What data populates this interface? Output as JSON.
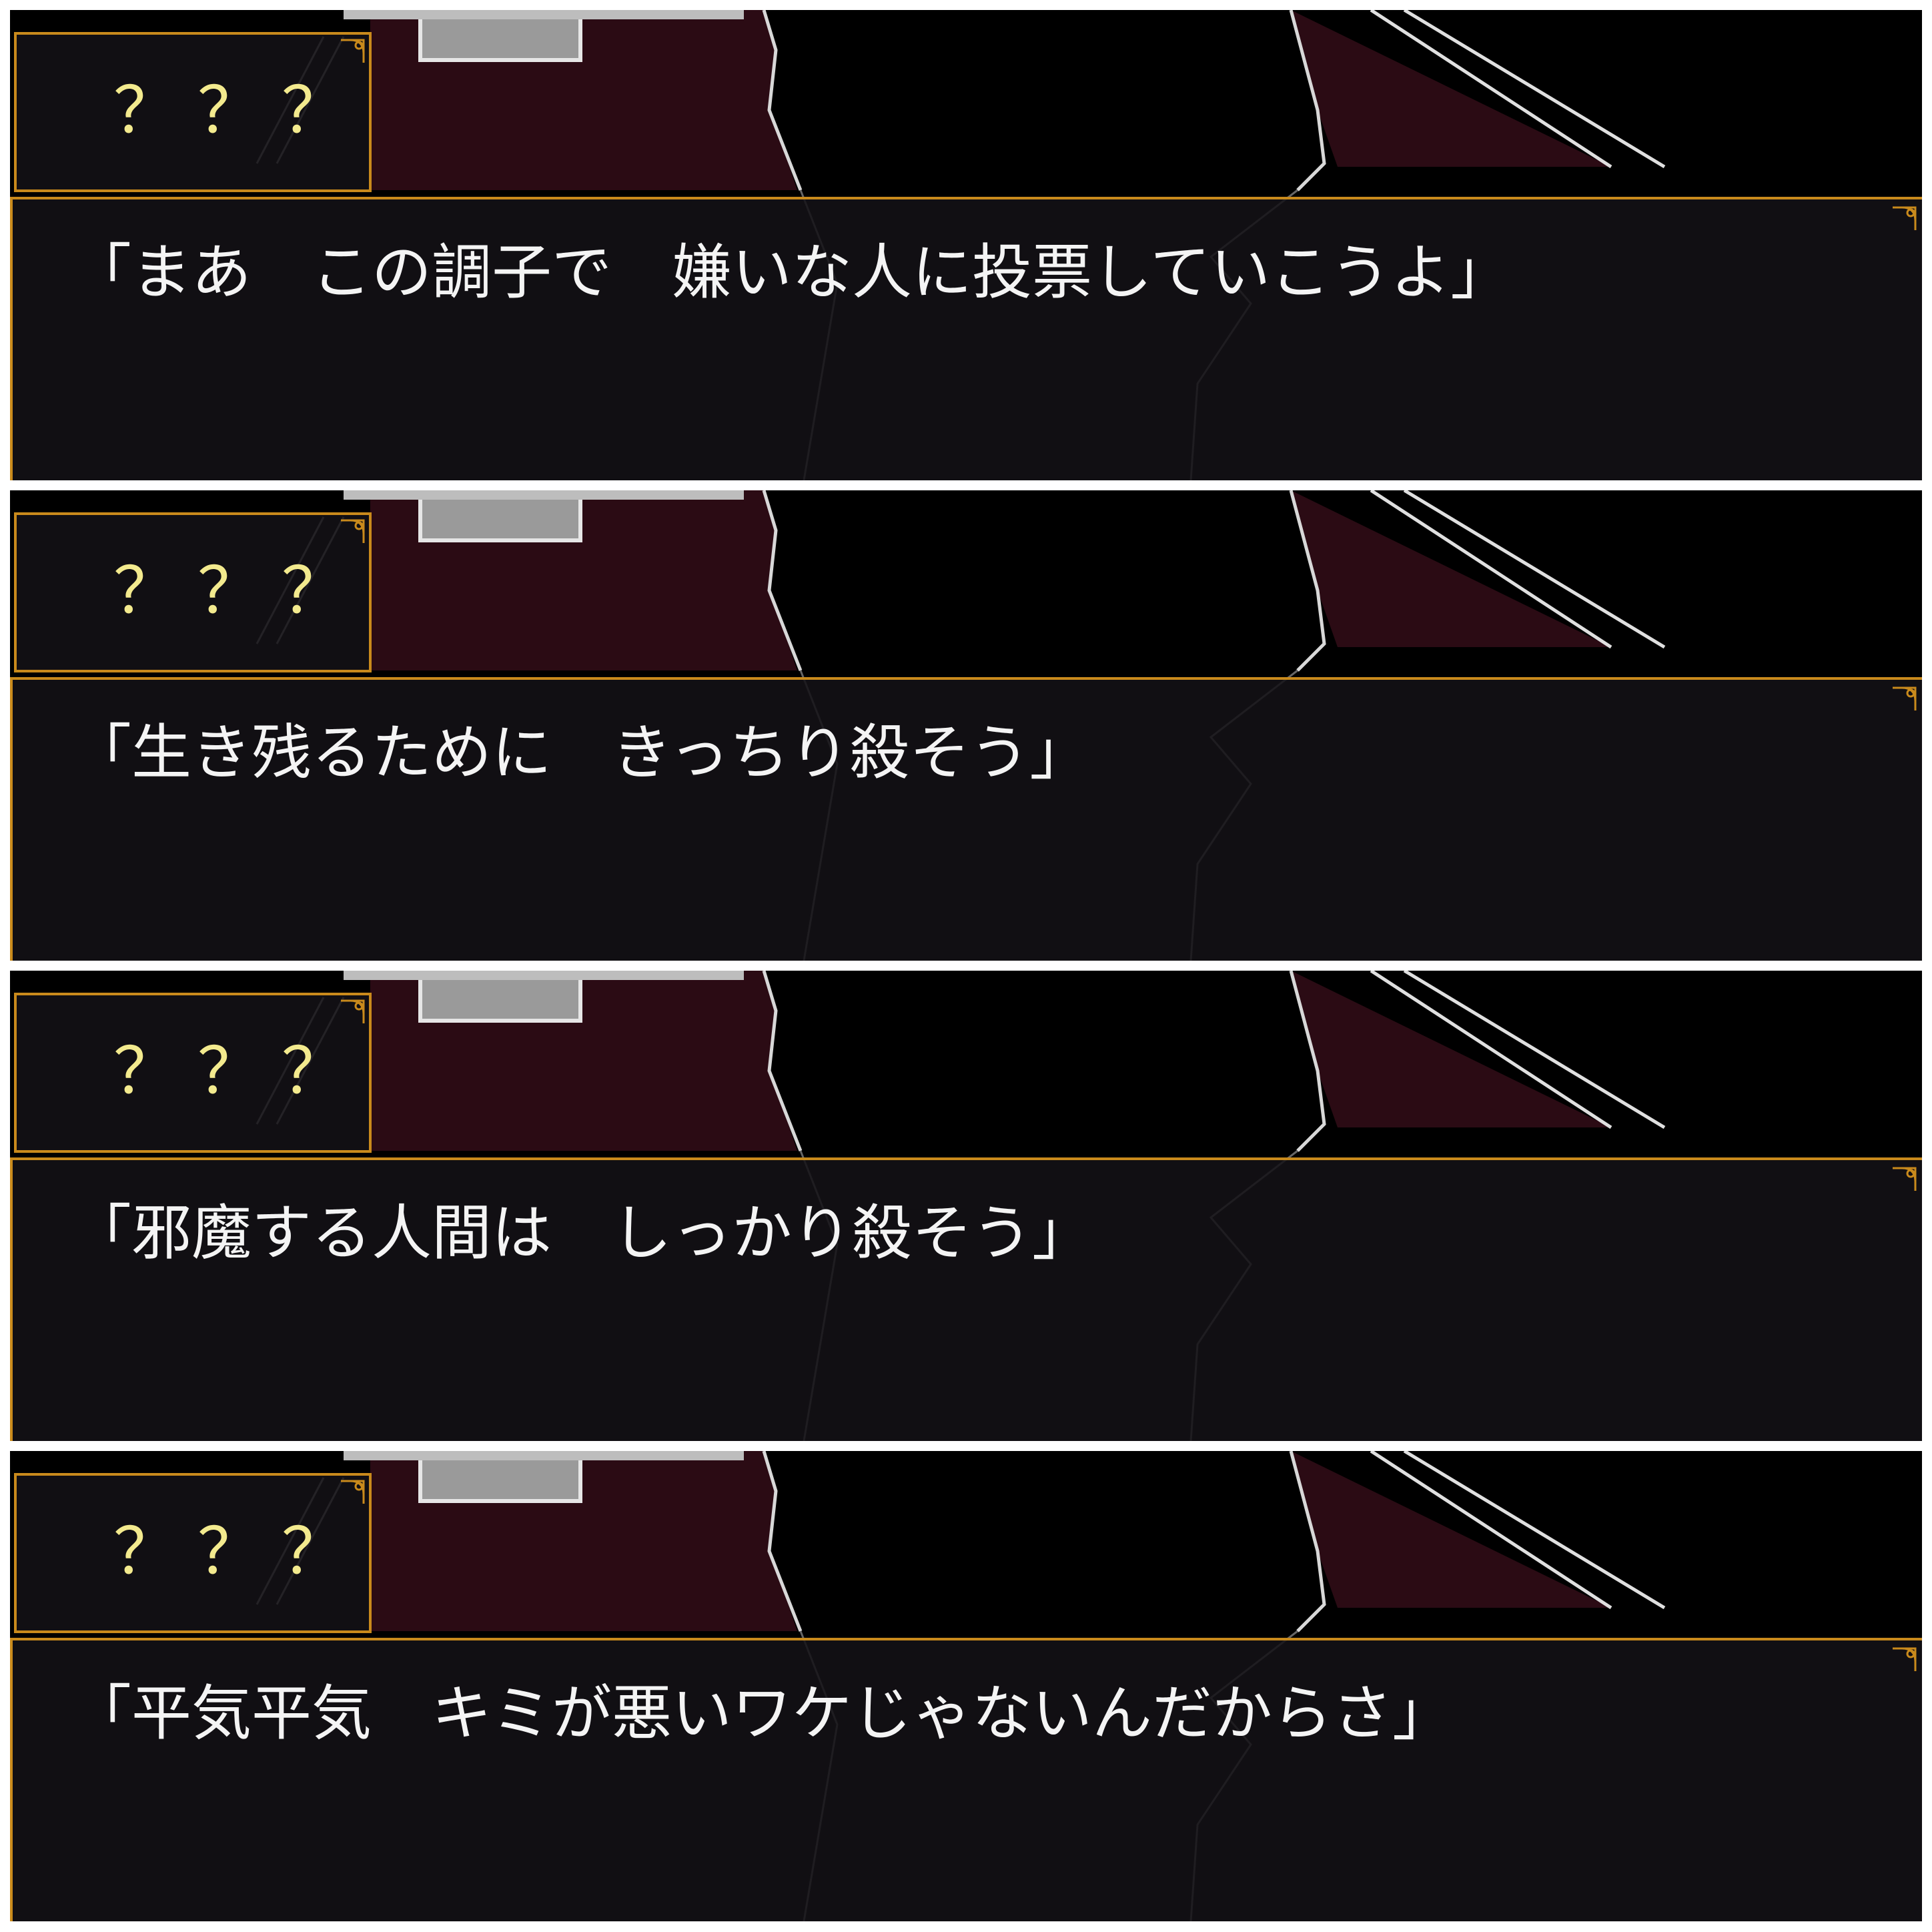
{
  "colors": {
    "frame_orange": "#c98a1c",
    "name_yellow": "#f3ea8e",
    "message_white": "#f4f4f4",
    "wall_maroon": "#2b0b14",
    "window_bg": "#141216"
  },
  "icons": {
    "window_corner": "ornament-corner-icon"
  },
  "panels": [
    {
      "speaker": "？？？",
      "message": "「まあ　この調子で　嫌いな人に投票していこうよ」"
    },
    {
      "speaker": "？？？",
      "message": "「生き残るために　きっちり殺そう」"
    },
    {
      "speaker": "？？？",
      "message": "「邪魔する人間は　しっかり殺そう」"
    },
    {
      "speaker": "？？？",
      "message": "「平気平気　キミが悪いワケじゃないんだからさ」"
    }
  ]
}
